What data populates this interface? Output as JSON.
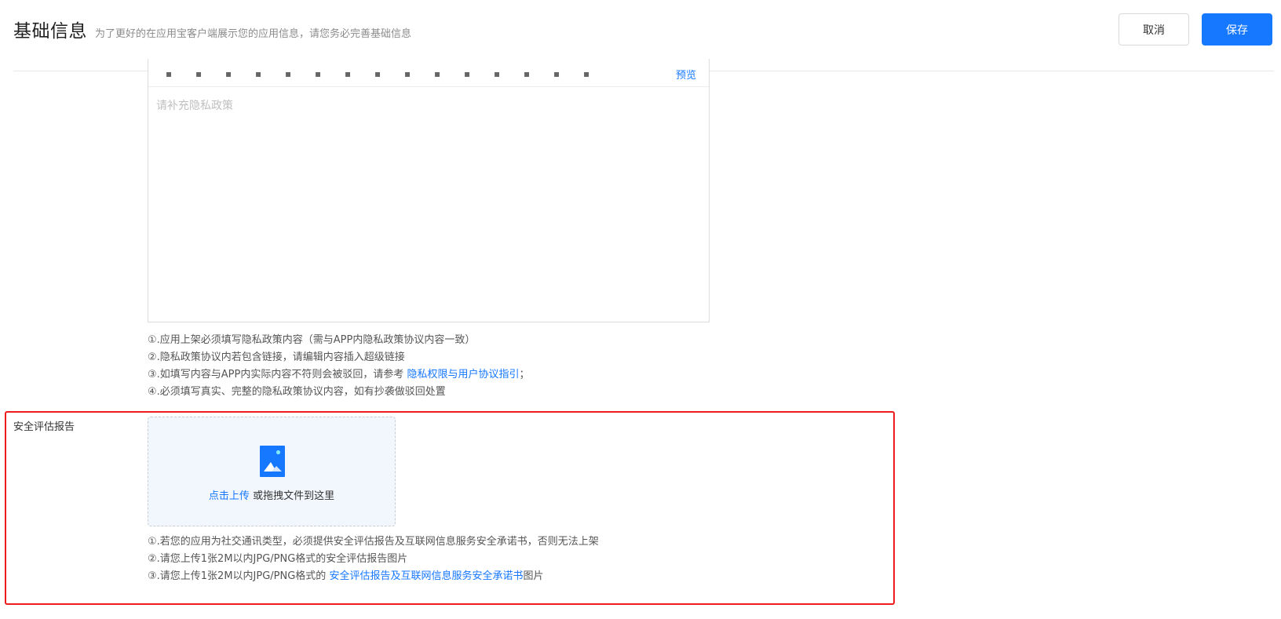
{
  "header": {
    "title": "基础信息",
    "subtitle": "为了更好的在应用宝客户端展示您的应用信息，请您务必完善基础信息",
    "cancel_label": "取消",
    "save_label": "保存"
  },
  "editor": {
    "preview_label": "预览",
    "placeholder": "请补充隐私政策"
  },
  "privacy_notes": {
    "n1": "①.应用上架必须填写隐私政策内容（需与APP内隐私政策协议内容一致）",
    "n2": "②.隐私政策协议内若包含链接，请编辑内容插入超级链接",
    "n3_prefix": "③.如填写内容与APP内实际内容不符则会被驳回，请参考 ",
    "n3_link": "隐私权限与用户协议指引",
    "n3_suffix": "；",
    "n4": "④.必须填写真实、完整的隐私政策协议内容，如有抄袭做驳回处置"
  },
  "security": {
    "label": "安全评估报告",
    "upload_action": "点击上传",
    "upload_hint": " 或拖拽文件到这里",
    "n1": "①.若您的应用为社交通讯类型，必须提供安全评估报告及互联网信息服务安全承诺书，否则无法上架",
    "n2": "②.请您上传1张2M以内JPG/PNG格式的安全评估报告图片",
    "n3_prefix": "③.请您上传1张2M以内JPG/PNG格式的 ",
    "n3_link": "安全评估报告及互联网信息服务安全承诺书",
    "n3_suffix": "图片"
  },
  "icons": {
    "upload": "image-upload-icon"
  },
  "colors": {
    "primary": "#1677ff",
    "highlight_border": "#ee1c1c",
    "upload_bg": "#f2f7fd"
  }
}
